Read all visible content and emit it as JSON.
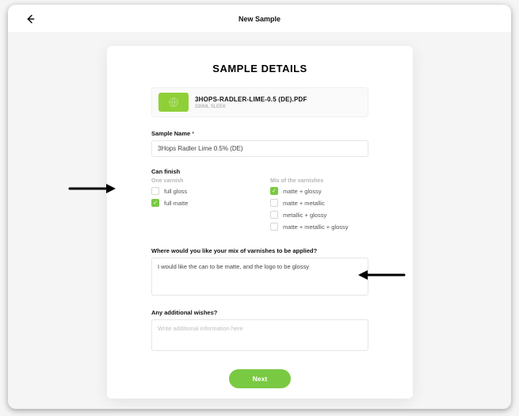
{
  "header": {
    "title": "New Sample"
  },
  "card": {
    "title": "SAMPLE DETAILS",
    "file": {
      "name": "3HOPS-RADLER-LIME-0.5 (DE).PDF",
      "size": "330ML SLEEK"
    },
    "sample_name_label": "Sample Name",
    "sample_name_value": "3Hops Radler Lime 0.5% (DE)",
    "can_finish_label": "Can finish",
    "one_varnish_label": "One varnish",
    "mix_label": "Mix of the varnishes",
    "one_varnish": [
      {
        "label": "full gloss",
        "checked": false
      },
      {
        "label": "full matte",
        "checked": true
      }
    ],
    "mix_varnish": [
      {
        "label": "matte + glossy",
        "checked": true
      },
      {
        "label": "matte + metallic",
        "checked": false
      },
      {
        "label": "metallic + glossy",
        "checked": false
      },
      {
        "label": "matte + metallic + glossy",
        "checked": false
      }
    ],
    "apply_label": "Where would you like your mix of varnishes to be applied?",
    "apply_value": "I would like the can to be matte, and the logo to be glossy",
    "wishes_label": "Any additional wishes?",
    "wishes_placeholder": "Write additional information here",
    "next_label": "Next"
  }
}
